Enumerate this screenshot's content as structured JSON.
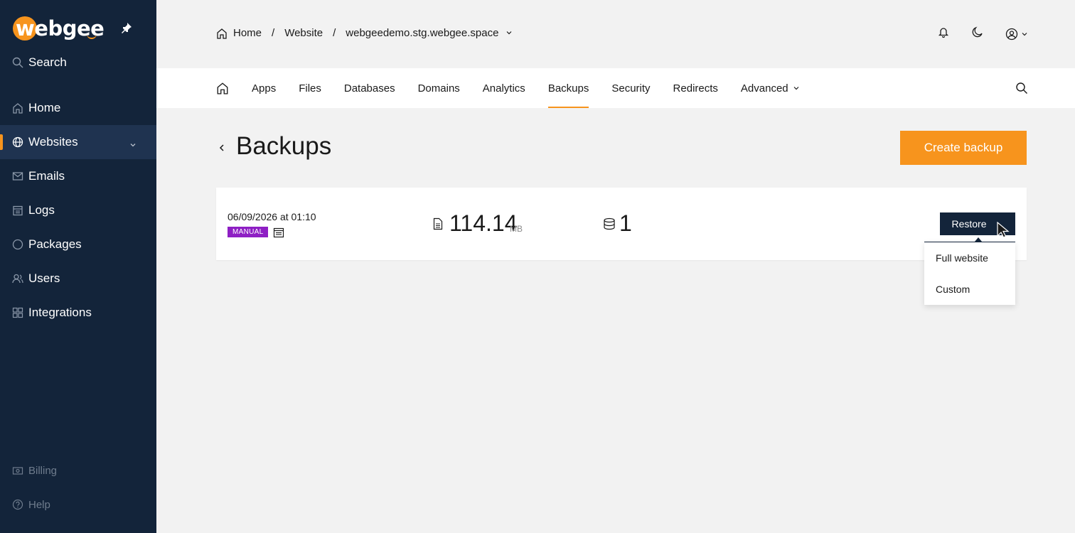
{
  "brand": {
    "name": "webgee",
    "accent": "#f7941d",
    "sidebar_bg": "#13243a"
  },
  "sidebar": {
    "search_label": "Search",
    "items": [
      {
        "label": "Home",
        "icon": "home-icon"
      },
      {
        "label": "Websites",
        "icon": "globe-icon",
        "active": true
      },
      {
        "label": "Emails",
        "icon": "mail-icon"
      },
      {
        "label": "Logs",
        "icon": "logs-icon"
      },
      {
        "label": "Packages",
        "icon": "package-icon"
      },
      {
        "label": "Users",
        "icon": "users-icon"
      },
      {
        "label": "Integrations",
        "icon": "integrations-icon"
      }
    ],
    "bottom": [
      {
        "label": "Billing",
        "icon": "billing-icon"
      },
      {
        "label": "Help",
        "icon": "help-icon"
      }
    ]
  },
  "breadcrumb": {
    "home": "Home",
    "sep1": "/",
    "website": "Website",
    "sep2": "/",
    "domain": "webgeedemo.stg.webgee.space"
  },
  "tabs": [
    "Apps",
    "Files",
    "Databases",
    "Domains",
    "Analytics",
    "Backups",
    "Security",
    "Redirects",
    "Advanced"
  ],
  "active_tab": "Backups",
  "page": {
    "title": "Backups",
    "create_button": "Create backup"
  },
  "backup": {
    "date": "06/09/2026 at 01:10",
    "badge": "MANUAL",
    "badge_color": "#8e1fc4",
    "size": "114.14",
    "size_unit": "MB",
    "databases": "1"
  },
  "restore": {
    "label": "Restore",
    "options": [
      "Full website",
      "Custom"
    ]
  }
}
